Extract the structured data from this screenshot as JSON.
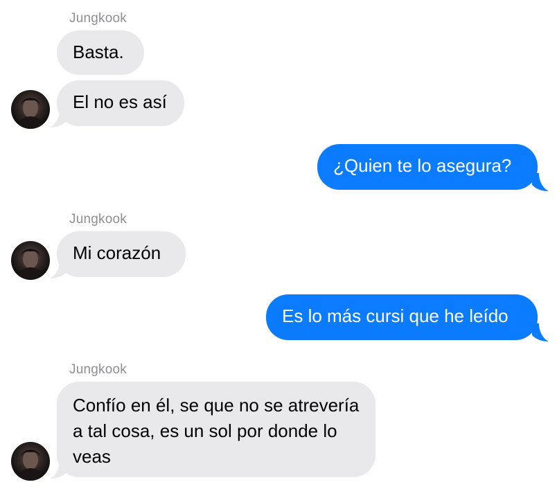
{
  "colors": {
    "incoming_bubble": "#e9e9eb",
    "outgoing_bubble": "#0b7cff",
    "sender_name": "#8e8e93"
  },
  "messages": [
    {
      "sender": "Jungkook",
      "text": "Basta.",
      "direction": "incoming"
    },
    {
      "text": "El no es así",
      "direction": "incoming"
    },
    {
      "text": "¿Quien te lo asegura?",
      "direction": "outgoing"
    },
    {
      "sender": "Jungkook",
      "text": "Mi corazón",
      "direction": "incoming"
    },
    {
      "text": "Es lo más cursi que he leído",
      "direction": "outgoing"
    },
    {
      "sender": "Jungkook",
      "text": "Confío en él, se que no se atrevería a tal cosa, es un sol por donde lo veas",
      "direction": "incoming"
    }
  ],
  "avatar_icon": "contact-photo-icon"
}
